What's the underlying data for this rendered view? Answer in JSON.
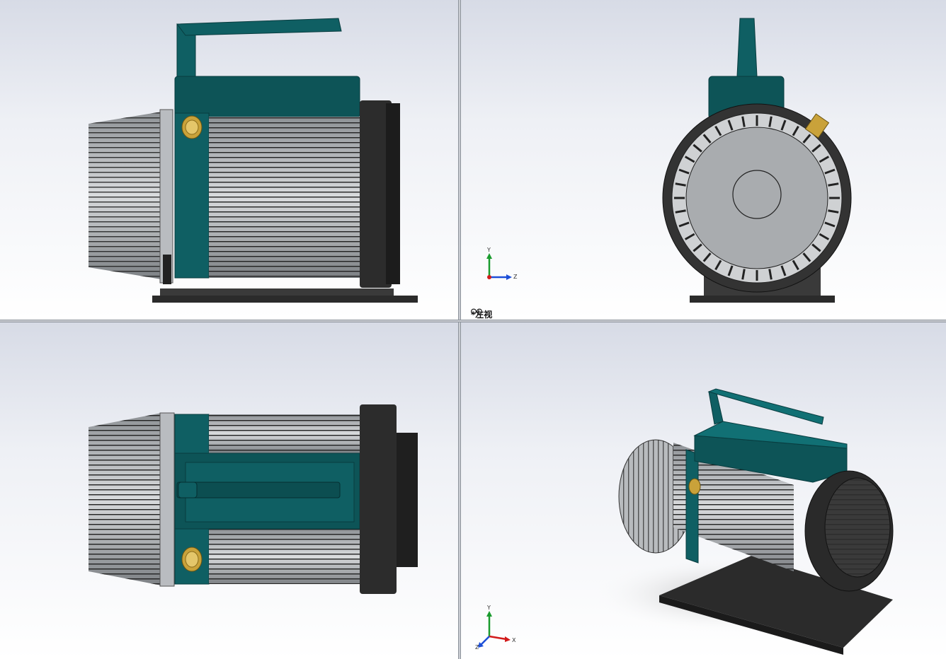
{
  "views": {
    "top_left": {
      "name": "side"
    },
    "top_right": {
      "name": "left",
      "label": "*左视"
    },
    "bottom_left": {
      "name": "top"
    },
    "bottom_right": {
      "name": "isometric"
    }
  },
  "triad_tr": {
    "y": "Y",
    "z": "Z"
  },
  "triad_br": {
    "y": "Y",
    "x": "X",
    "z": "Z"
  },
  "colors": {
    "body_teal": "#0f5f63",
    "fins": "#a8acb0",
    "dark": "#2a2a2a",
    "brass": "#c9a23a"
  }
}
